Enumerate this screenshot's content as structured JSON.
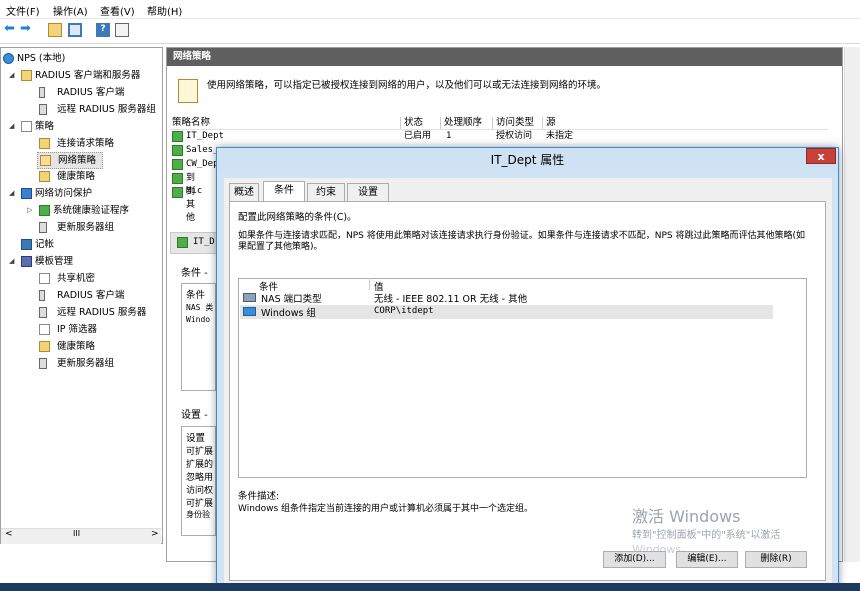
{
  "menu": {
    "file": "文件(F)",
    "action": "操作(A)",
    "view": "查看(V)",
    "help": "帮助(H)"
  },
  "tree": {
    "items": [
      {
        "label": "NPS (本地)"
      },
      {
        "label": "RADIUS 客户端和服务器"
      },
      {
        "label": "RADIUS 客户端"
      },
      {
        "label": "远程 RADIUS 服务器组"
      },
      {
        "label": "策略"
      },
      {
        "label": "连接请求策略"
      },
      {
        "label": "网络策略"
      },
      {
        "label": "健康策略"
      },
      {
        "label": "网络访问保护"
      },
      {
        "label": "系统健康验证程序"
      },
      {
        "label": "更新服务器组"
      },
      {
        "label": "记帐"
      },
      {
        "label": "模板管理"
      },
      {
        "label": "共享机密"
      },
      {
        "label": "RADIUS 客户端"
      },
      {
        "label": "远程 RADIUS 服务器"
      },
      {
        "label": "IP 筛选器"
      },
      {
        "label": "健康策略"
      },
      {
        "label": "更新服务器组"
      }
    ],
    "scroll_mid": "III"
  },
  "right": {
    "header": "网络策略",
    "description": "使用网络策略，可以指定已被授权连接到网络的用户，以及他们可以或无法连接到网络的环境。",
    "columns": {
      "name": "策略名称",
      "status": "状态",
      "order": "处理顺序",
      "access": "访问类型",
      "source": "源"
    },
    "rows": [
      {
        "name": "IT_Dept",
        "status": "已启用",
        "order": "1",
        "access": "授权访问",
        "source": "未指定"
      },
      {
        "name": "Sales_"
      },
      {
        "name": "CW_Dep"
      },
      {
        "name": "到 Mic"
      },
      {
        "name": "到其他"
      }
    ],
    "detail_title": "IT_D",
    "cond_section": "条件 -",
    "cond_lines": [
      "条件",
      "NAS 类",
      "Windo"
    ],
    "settings_section": "设置 -",
    "settings_lines": [
      "设置",
      "可扩展",
      "扩展的",
      "忽略用",
      "访问权",
      "可扩展",
      "身份验"
    ]
  },
  "dialog": {
    "title": "IT_Dept 属性",
    "close": "x",
    "tabs": [
      "概述",
      "条件",
      "约束",
      "设置"
    ],
    "intro": "配置此网络策略的条件(C)。",
    "explain": "如果条件与连接请求匹配，NPS 将使用此策略对该连接请求执行身份验证。如果条件与连接请求不匹配，NPS 将跳过此策略而评估其他策略(如果配置了其他策略)。",
    "list_headers": {
      "condition": "条件",
      "value": "值"
    },
    "conditions": [
      {
        "name": "NAS 端口类型",
        "value": "无线 - IEEE 802.11 OR 无线 - 其他"
      },
      {
        "name": "Windows 组",
        "value": "CORP\\itdept"
      }
    ],
    "desc_label": "条件描述:",
    "desc_text": "Windows 组条件指定当前连接的用户或计算机必须属于其中一个选定组。",
    "buttons": {
      "add": "添加(D)...",
      "edit": "编辑(E)...",
      "remove": "删除(R)"
    }
  },
  "watermark": {
    "line1": "激活 Windows",
    "line2": "转到\"控制面板\"中的\"系统\"以激活",
    "line3": "Windows。"
  },
  "colors": {
    "title_bar": "#cfe2f3",
    "close": "#c7403a",
    "pane_header": "#5f5f5f",
    "selected_row": "#e5e5e5"
  }
}
